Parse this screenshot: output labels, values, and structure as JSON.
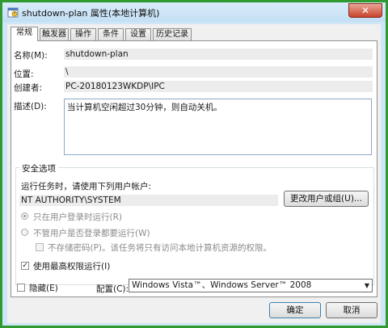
{
  "window": {
    "title": "shutdown-plan 属性(本地计算机)",
    "close_glyph": "✕"
  },
  "tabs": [
    {
      "label": "常规",
      "active": true
    },
    {
      "label": "触发器",
      "active": false
    },
    {
      "label": "操作",
      "active": false
    },
    {
      "label": "条件",
      "active": false
    },
    {
      "label": "设置",
      "active": false
    },
    {
      "label": "历史记录",
      "active": false
    }
  ],
  "general": {
    "name_label": "名称(M):",
    "name_value": "shutdown-plan",
    "location_label": "位置:",
    "location_value": "\\",
    "author_label": "创建者:",
    "author_value": "PC-20180123WKDP\\IPC",
    "description_label": "描述(D):",
    "description_value": "当计算机空闲超过30分钟，则自动关机。"
  },
  "security": {
    "group_title": "安全选项",
    "run_as_prompt": "运行任务时，请使用下列用户帐户:",
    "account": "NT AUTHORITY\\SYSTEM",
    "change_user_button": "更改用户或组(U)...",
    "radio_logged_on": "只在用户登录时运行(R)",
    "radio_logged_on_selected": true,
    "radio_whether_logged": "不管用户是否登录都要运行(W)",
    "radio_whether_logged_selected": false,
    "no_store_password": "不存储密码(P)。该任务将只有访问本地计算机资源的权限。",
    "no_store_password_checked": false,
    "highest_privileges": "使用最高权限运行(I)",
    "highest_privileges_checked": true,
    "check_glyph": "✓"
  },
  "bottom": {
    "hidden_label": "隐藏(E)",
    "hidden_checked": false,
    "configure_label": "配置(C):",
    "configure_value": "Windows Vista™、Windows Server™ 2008",
    "ok_button": "确定",
    "cancel_button": "取消"
  },
  "icons": {
    "title_icon": "task-scheduler-icon",
    "dropdown_icon": "chevron-down-icon",
    "dropdown_glyph": "▼"
  },
  "colors": {
    "frame_border": "#2f9a2f",
    "title_bar": "#cfe6f7",
    "close_button": "#c9442c"
  }
}
